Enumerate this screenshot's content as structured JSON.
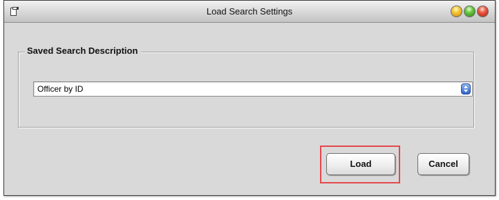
{
  "window": {
    "title": "Load Search Settings"
  },
  "titlebar": {
    "app_icon": "window-app-icon",
    "buttons": [
      "minimize",
      "maximize",
      "close"
    ]
  },
  "group": {
    "label": "Saved Search Description"
  },
  "saved_search_select": {
    "value": "Officer by ID"
  },
  "actions": {
    "load_label": "Load",
    "cancel_label": "Cancel"
  },
  "colors": {
    "window_bg": "#d9d9d9",
    "highlight": "#e4474d",
    "select_arrow": "#2e62c8"
  }
}
